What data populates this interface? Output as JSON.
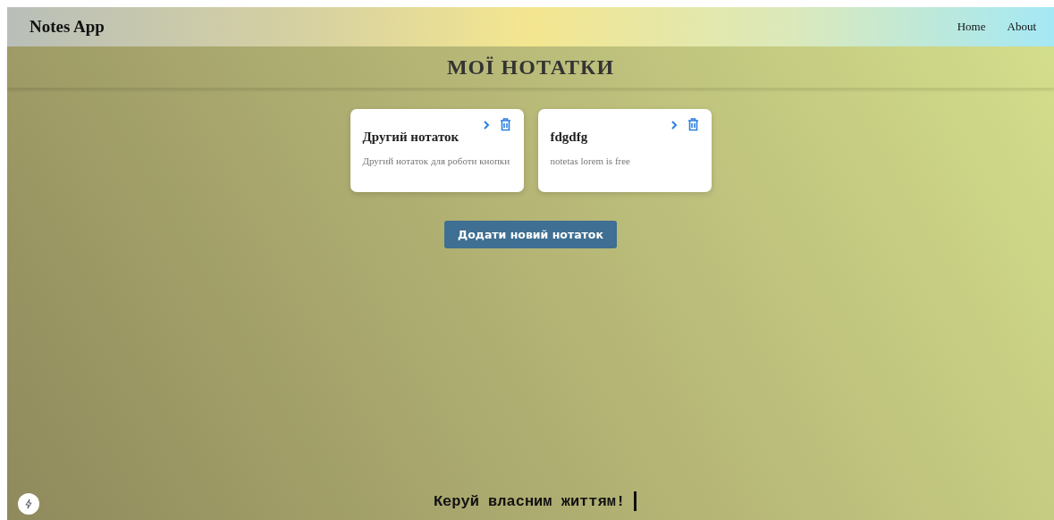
{
  "navbar": {
    "brand": "Notes App",
    "links": [
      "Home",
      "About"
    ]
  },
  "page_title": "МОЇ НОТАТКИ",
  "notes": [
    {
      "title": "Другий нотаток",
      "text": "Другий нотаток для роботи кнопки"
    },
    {
      "title": "fdgdfg",
      "text": "notetas lorem is free"
    }
  ],
  "add_button": "Додати новий нотаток",
  "footer": {
    "slogan": "Керуй власним життям!"
  }
}
